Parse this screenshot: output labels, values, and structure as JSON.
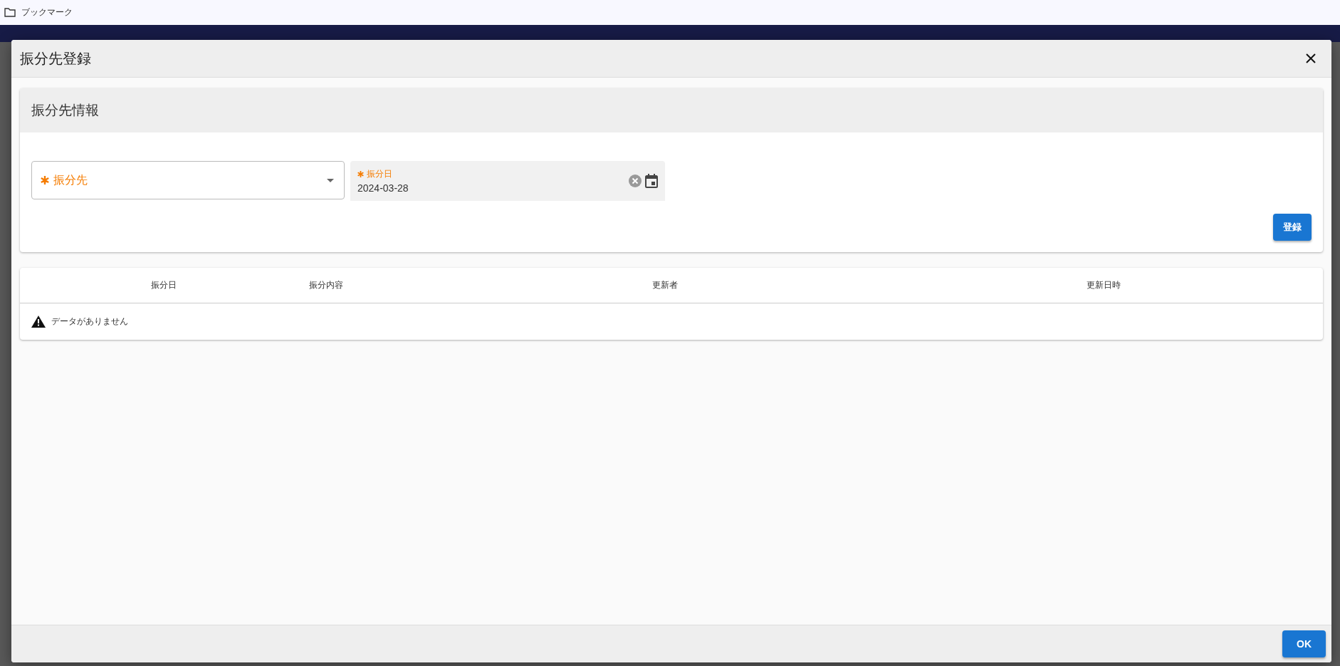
{
  "bookmarks_bar": {
    "label": "ブックマーク"
  },
  "dialog": {
    "title": "振分先登録",
    "section": {
      "title": "振分先情報",
      "fields": [
        {
          "kind": "select",
          "label": "振分先",
          "required": true
        },
        {
          "kind": "date",
          "label": "振分日",
          "required": true,
          "value": "2024-03-28"
        }
      ],
      "submit": "登録"
    },
    "table": {
      "columns": [
        "振分日",
        "振分内容",
        "更新者",
        "更新日時"
      ],
      "empty_message": "データがありません"
    },
    "buttons": [
      "OK"
    ]
  }
}
